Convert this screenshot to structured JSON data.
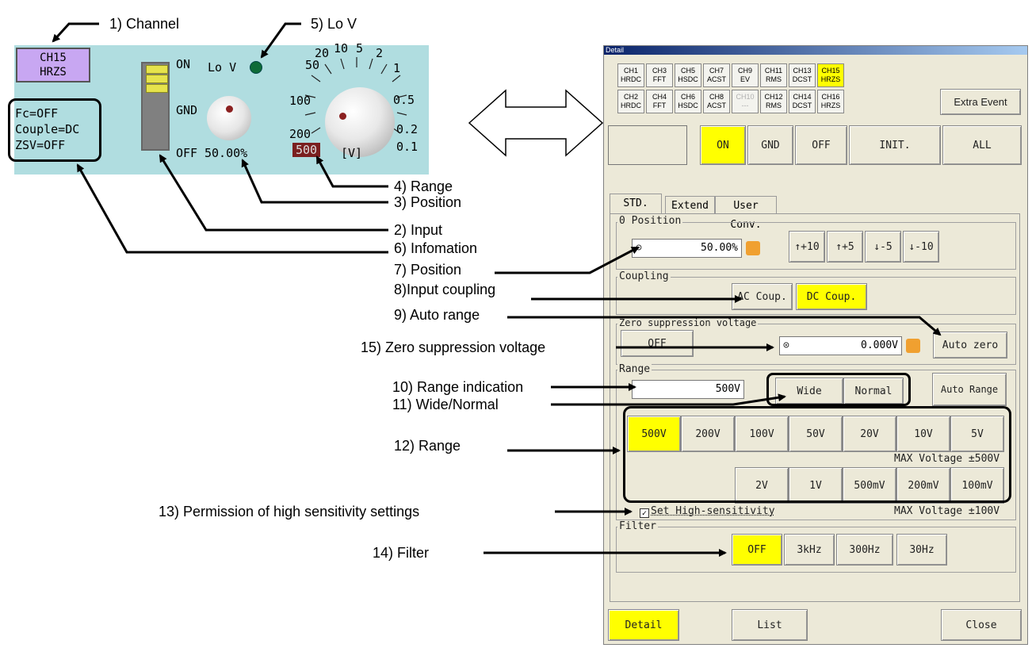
{
  "callouts": {
    "c1": "1) Channel",
    "c5": "5) Lo V",
    "c4": "4) Range",
    "c3": "3) Position",
    "c2": "2) Input",
    "c6": "6) Infomation",
    "c7": "7) Position",
    "c8": "8)Input coupling",
    "c9": "9) Auto range",
    "c15": "15) Zero suppression voltage",
    "c10": "10) Range indication",
    "c11": "11) Wide/Normal",
    "c12": "12) Range",
    "c13": "13) Permission of high sensitivity settings",
    "c14": "14) Filter"
  },
  "channel_panel": {
    "channel_name": "CH15",
    "channel_type": "HRZS",
    "info": [
      "Fc=OFF",
      "Couple=DC",
      "ZSV=OFF"
    ],
    "switch_on": "ON",
    "switch_gnd": "GND",
    "switch_off": "OFF",
    "lov_label": "Lo V",
    "position_value": "50.00%",
    "range_scale": [
      "20",
      "10",
      "5",
      "2",
      "50",
      "1",
      "100",
      "0.5",
      "200",
      "0.2",
      "0.1"
    ],
    "range_selected": "500",
    "range_unit": "[V]"
  },
  "detail": {
    "title": "Detail",
    "channels_row1": [
      {
        "top": "CH1",
        "bottom": "HRDC"
      },
      {
        "top": "CH3",
        "bottom": "FFT"
      },
      {
        "top": "CH5",
        "bottom": "HSDC"
      },
      {
        "top": "CH7",
        "bottom": "ACST"
      },
      {
        "top": "CH9",
        "bottom": "EV"
      },
      {
        "top": "CH11",
        "bottom": "RMS"
      },
      {
        "top": "CH13",
        "bottom": "DCST"
      },
      {
        "top": "CH15",
        "bottom": "HRZS"
      }
    ],
    "channels_row2": [
      {
        "top": "CH2",
        "bottom": "HRDC"
      },
      {
        "top": "CH4",
        "bottom": "FFT"
      },
      {
        "top": "CH6",
        "bottom": "HSDC"
      },
      {
        "top": "CH8",
        "bottom": "ACST"
      },
      {
        "top": "CH10",
        "bottom": "---"
      },
      {
        "top": "CH12",
        "bottom": "RMS"
      },
      {
        "top": "CH14",
        "bottom": "DCST"
      },
      {
        "top": "CH16",
        "bottom": "HRZS"
      }
    ],
    "extra_event": "Extra Event",
    "input_buttons": [
      "ON",
      "GND",
      "OFF",
      "INIT.",
      "ALL"
    ],
    "tabs": [
      "STD.",
      "Extend",
      "User Conv."
    ],
    "zero_position": {
      "title": "0 Position",
      "value": "50.00%",
      "steps": [
        "↑+10",
        "↑+5",
        "↓-5",
        "↓-10"
      ]
    },
    "coupling": {
      "title": "Coupling",
      "ac": "AC Coup.",
      "dc": "DC Coup."
    },
    "zero_suppression": {
      "title": "Zero suppression voltage",
      "off": "OFF",
      "value": "0.000V",
      "auto_zero": "Auto zero"
    },
    "range": {
      "title": "Range",
      "value": "500V",
      "wide": "Wide",
      "normal": "Normal",
      "auto_range": "Auto Range",
      "row1": [
        "500V",
        "200V",
        "100V",
        "50V",
        "20V",
        "10V",
        "5V"
      ],
      "max1": "MAX Voltage ±500V",
      "row2": [
        "2V",
        "1V",
        "500mV",
        "200mV",
        "100mV"
      ],
      "high_sens": "Set High-sensitivity",
      "max2": "MAX Voltage ±100V"
    },
    "filter": {
      "title": "Filter",
      "options": [
        "OFF",
        "3kHz",
        "300Hz",
        "30Hz"
      ]
    },
    "bottom": {
      "detail": "Detail",
      "list": "List",
      "close": "Close"
    }
  }
}
